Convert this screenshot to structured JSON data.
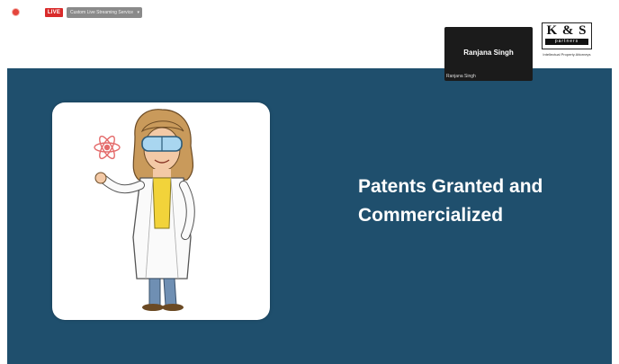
{
  "toolbar": {
    "live_badge": "LIVE",
    "live_menu_label": "Custom Live Streaming Service",
    "live_menu_chevron": "▾"
  },
  "participant": {
    "display_name": "Ranjana Singh",
    "name_label": "Ranjana Singh"
  },
  "logo": {
    "main": "K & S",
    "sub": "partners",
    "tagline": "Intellectual Property Attorneys"
  },
  "slide": {
    "title_line1": "Patents Granted and",
    "title_line2": "Commercialized",
    "background": "#1f4f6d"
  },
  "icons": {
    "recording": "recording-dot-icon",
    "atom": "atom-icon"
  }
}
